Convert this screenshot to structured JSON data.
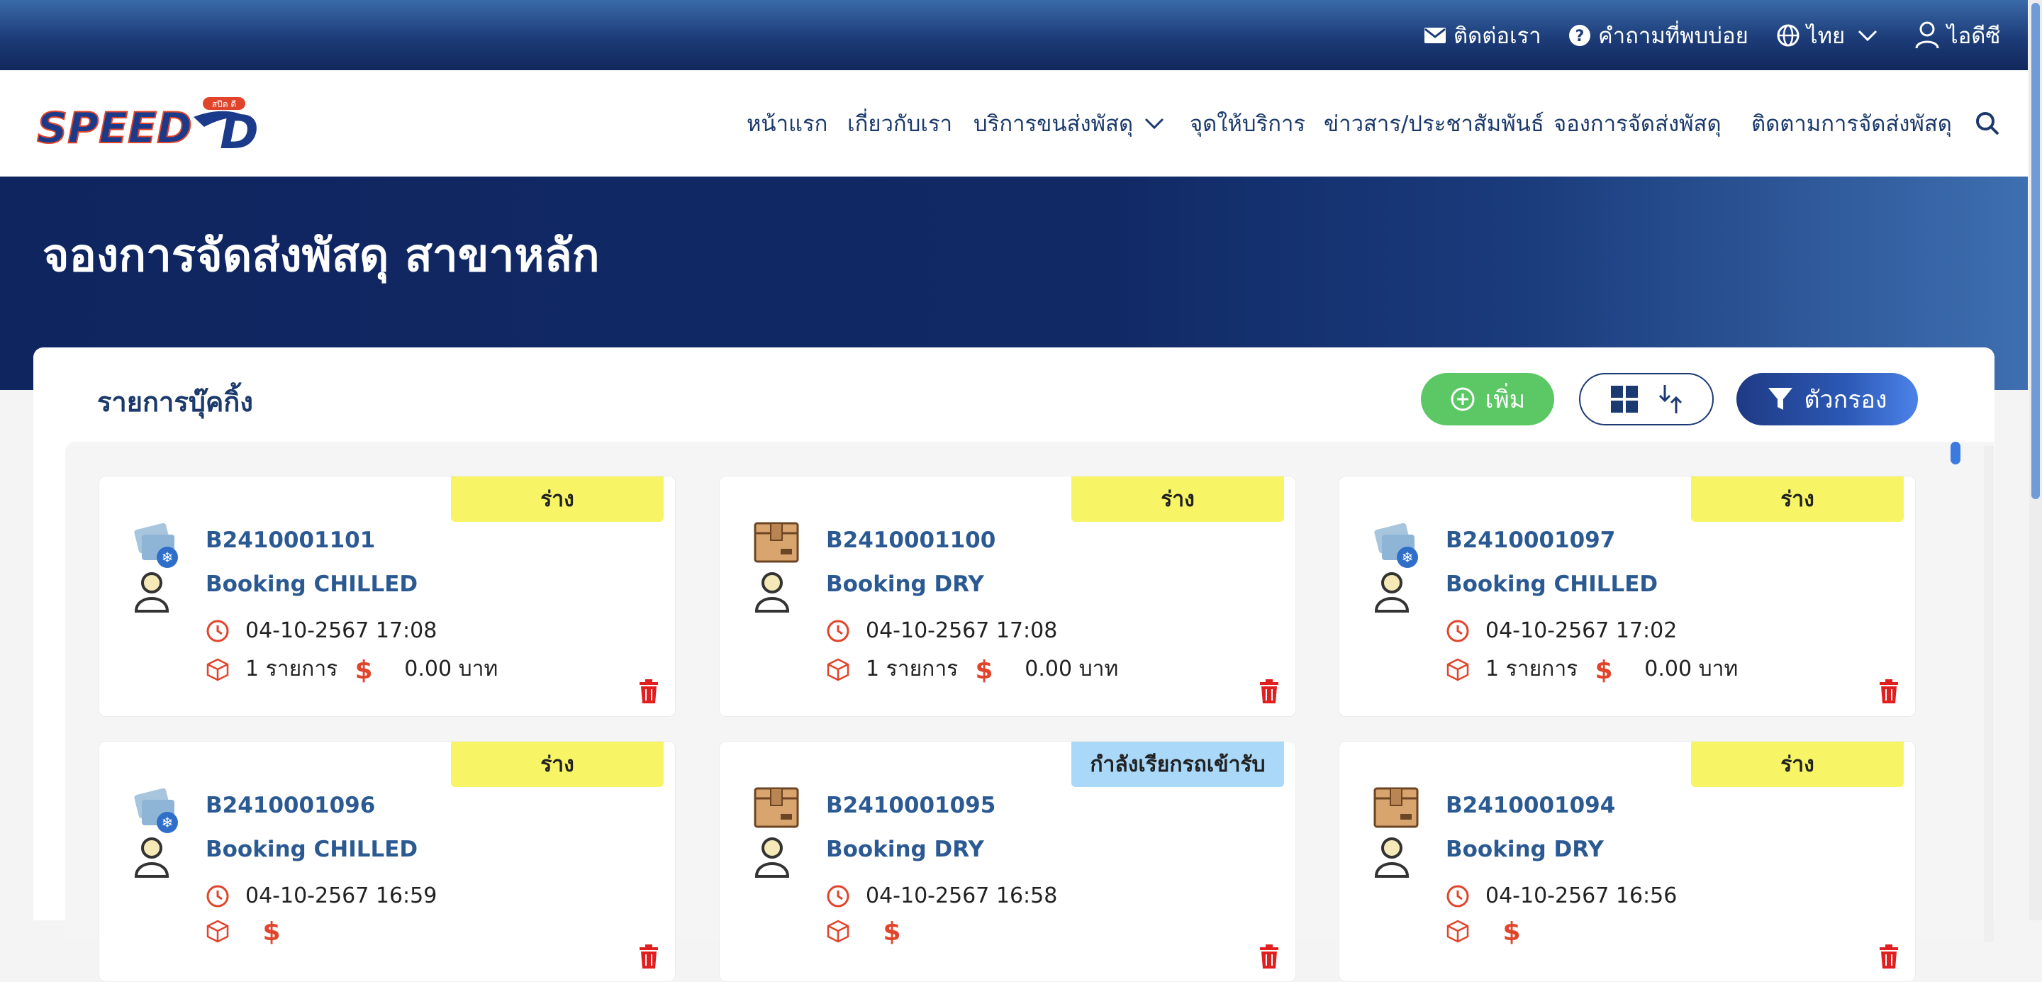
{
  "topbar": {
    "contact": "ติดต่อเรา",
    "faq": "คำถามที่พบบ่อย",
    "language": "ไทย",
    "user": "ไอดีซี"
  },
  "logo": {
    "text": "SPEED",
    "small": "สปีด ดี"
  },
  "nav": {
    "home": "หน้าแรก",
    "about": "เกี่ยวกับเรา",
    "services": "บริการขนส่งพัสดุ",
    "service_points": "จุดให้บริการ",
    "news": "ข่าวสาร/ประชาสัมพันธ์",
    "booking": "จองการจัดส่งพัสดุ",
    "tracking": "ติดตามการจัดส่งพัสดุ"
  },
  "hero": {
    "title": "จองการจัดส่งพัสดุ สาขาหลัก"
  },
  "panel": {
    "title": "รายการบุ๊คกิ้ง",
    "add_label": "เพิ่ม",
    "filter_label": "ตัวกรอง"
  },
  "bookings": [
    {
      "status": "ร่าง",
      "status_kind": "draft",
      "id": "B2410001101",
      "type": "Booking CHILLED",
      "icon": "chilled-icon",
      "datetime": "04-10-2567 17:08",
      "items": "1 รายการ",
      "amount": "0.00 บาท"
    },
    {
      "status": "ร่าง",
      "status_kind": "draft",
      "id": "B2410001100",
      "type": "Booking DRY",
      "icon": "dry-box-icon",
      "datetime": "04-10-2567 17:08",
      "items": "1 รายการ",
      "amount": "0.00 บาท"
    },
    {
      "status": "ร่าง",
      "status_kind": "draft",
      "id": "B2410001097",
      "type": "Booking CHILLED",
      "icon": "chilled-icon",
      "datetime": "04-10-2567 17:02",
      "items": "1 รายการ",
      "amount": "0.00 บาท"
    },
    {
      "status": "ร่าง",
      "status_kind": "draft",
      "id": "B2410001096",
      "type": "Booking CHILLED",
      "icon": "chilled-icon",
      "datetime": "04-10-2567 16:59",
      "items": "",
      "amount": ""
    },
    {
      "status": "กำลังเรียกรถเข้ารับ",
      "status_kind": "pickup",
      "id": "B2410001095",
      "type": "Booking DRY",
      "icon": "dry-box-icon",
      "datetime": "04-10-2567 16:58",
      "items": "",
      "amount": ""
    },
    {
      "status": "ร่าง",
      "status_kind": "draft",
      "id": "B2410001094",
      "type": "Booking DRY",
      "icon": "dry-box-icon",
      "datetime": "04-10-2567 16:56",
      "items": "",
      "amount": ""
    }
  ],
  "colors": {
    "brand_navy": "#12275c",
    "accent_blue": "#2b5a93",
    "draft": "#f7f565",
    "pickup": "#a9d8f8",
    "add_green": "#5cc765",
    "icon_red": "#e0452c"
  }
}
